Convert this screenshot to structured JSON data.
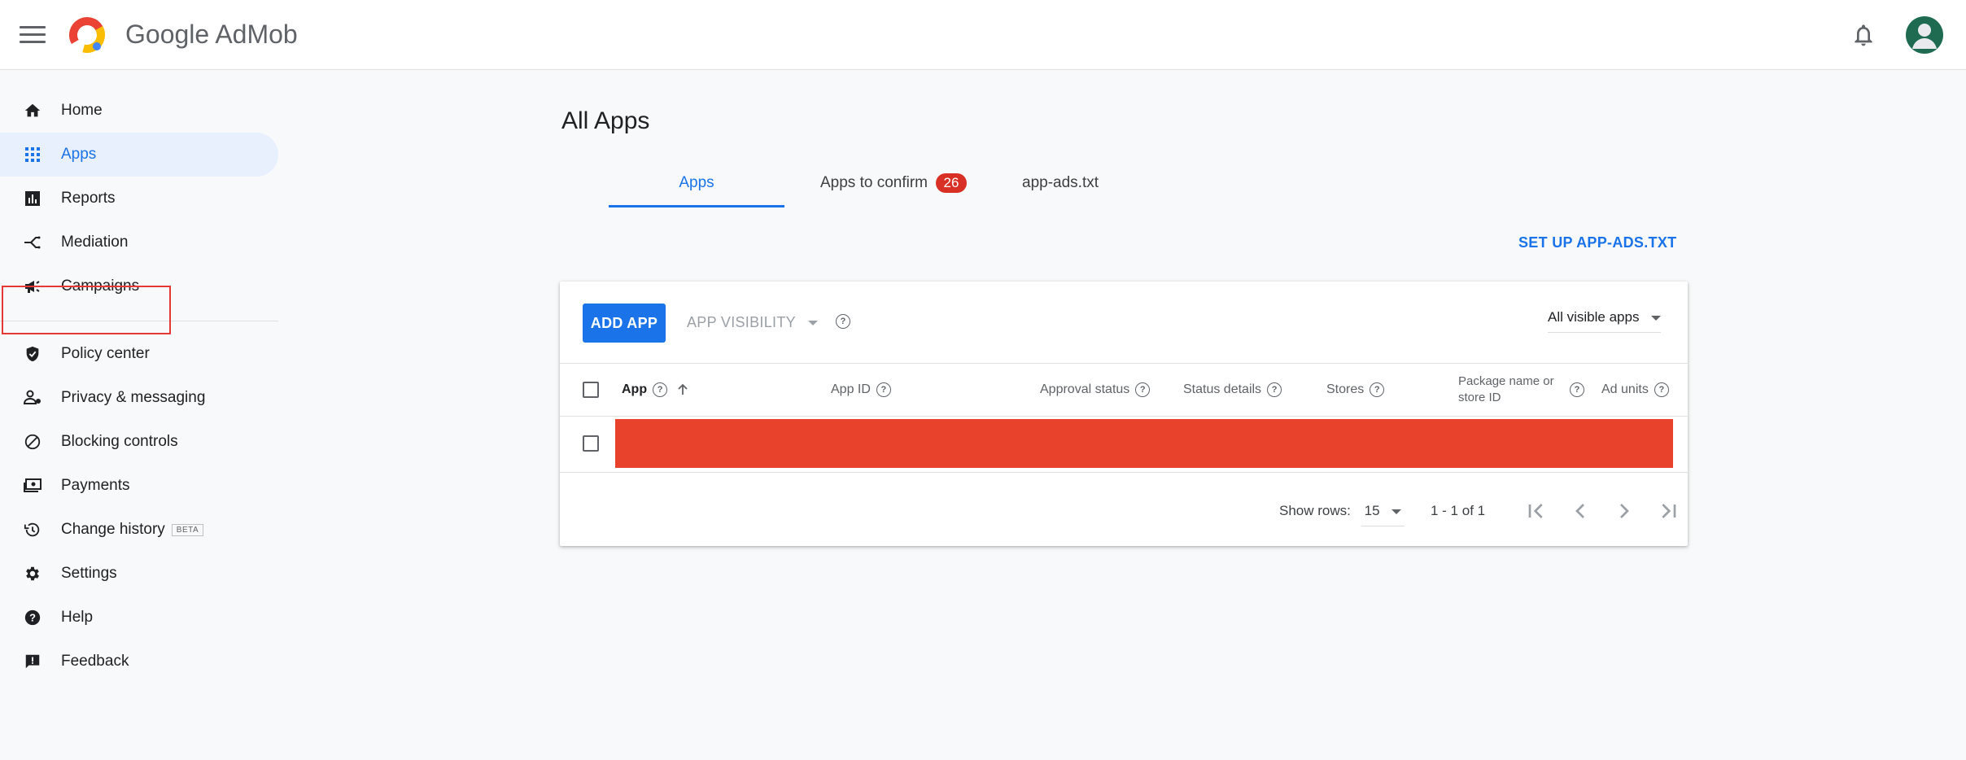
{
  "header": {
    "brand_google": "Google",
    "brand_product": "AdMob"
  },
  "sidebar": {
    "items": [
      {
        "label": "Home",
        "icon": "home-icon"
      },
      {
        "label": "Apps",
        "icon": "apps-grid-icon",
        "active": true
      },
      {
        "label": "Reports",
        "icon": "bar-chart-icon"
      },
      {
        "label": "Mediation",
        "icon": "mediation-icon"
      },
      {
        "label": "Campaigns",
        "icon": "megaphone-icon"
      },
      {
        "label": "Policy center",
        "icon": "shield-icon"
      },
      {
        "label": "Privacy & messaging",
        "icon": "person-settings-icon"
      },
      {
        "label": "Blocking controls",
        "icon": "block-icon"
      },
      {
        "label": "Payments",
        "icon": "payments-icon"
      },
      {
        "label": "Change history",
        "icon": "history-icon",
        "badge": "BETA"
      },
      {
        "label": "Settings",
        "icon": "gear-icon"
      },
      {
        "label": "Help",
        "icon": "help-icon"
      },
      {
        "label": "Feedback",
        "icon": "feedback-icon"
      }
    ]
  },
  "main": {
    "title": "All Apps",
    "tabs": [
      {
        "label": "Apps",
        "active": true
      },
      {
        "label": "Apps to confirm",
        "badge": "26"
      },
      {
        "label": "app-ads.txt"
      }
    ],
    "setup_link": "SET UP APP-ADS.TXT"
  },
  "card": {
    "add_button": "ADD APP",
    "visibility_dropdown": "APP VISIBILITY",
    "filter_value": "All visible apps",
    "columns": [
      {
        "label": "App"
      },
      {
        "label": "App ID"
      },
      {
        "label": "Approval status"
      },
      {
        "label": "Status details"
      },
      {
        "label": "Stores"
      },
      {
        "label": "Package name or store ID"
      },
      {
        "label": "Ad units"
      }
    ],
    "rows_label": "Show rows:",
    "rows_value": "15",
    "range": "1 - 1 of 1"
  },
  "colors": {
    "accent": "#1a73e8",
    "active_nav_bg": "#e8f0fe",
    "badge": "#d93025",
    "redaction": "#e8412c"
  }
}
